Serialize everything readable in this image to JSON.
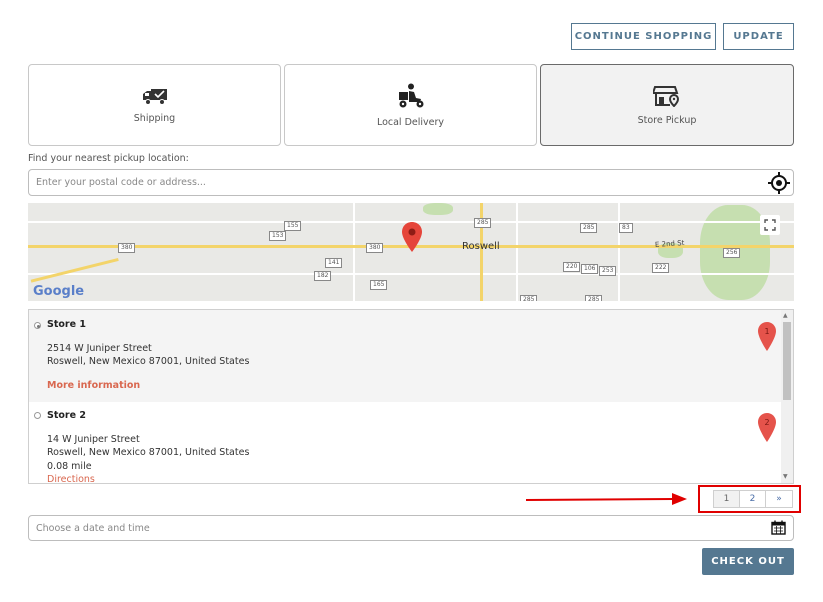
{
  "header": {
    "continue_shopping_label": "CONTINUE SHOPPING",
    "update_label": "UPDATE"
  },
  "tabs": [
    {
      "label": "Shipping",
      "icon": "truck-icon",
      "active": false
    },
    {
      "label": "Local Delivery",
      "icon": "scooter-delivery-icon",
      "active": false
    },
    {
      "label": "Store Pickup",
      "icon": "store-pin-icon",
      "active": true
    }
  ],
  "search": {
    "label": "Find your nearest pickup location:",
    "placeholder": "Enter your postal code or address..."
  },
  "map": {
    "provider_logo": "Google",
    "city_label": "Roswell",
    "street_label": "E 2nd St",
    "road_shields": [
      "155",
      "153",
      "380",
      "380",
      "285",
      "285",
      "83",
      "141",
      "182",
      "165",
      "220",
      "106",
      "253",
      "222",
      "256",
      "285",
      "285"
    ]
  },
  "stores": [
    {
      "name": "Store 1",
      "address_line1": "2514 W Juniper Street",
      "address_line2": "Roswell, New Mexico 87001, United States",
      "link": "More information",
      "marker": "1",
      "selected": true
    },
    {
      "name": "Store 2",
      "address_line1": "14 W Juniper Street",
      "address_line2": "Roswell, New Mexico 87001, United States",
      "distance": "0.08 mile",
      "link": "Directions",
      "marker": "2",
      "selected": false
    }
  ],
  "pagination": {
    "pages": [
      "1",
      "2"
    ],
    "next": "»",
    "current": "1"
  },
  "datetime": {
    "placeholder": "Choose a date and time"
  },
  "checkout_label": "CHECK OUT",
  "colors": {
    "accent": "#557891",
    "link": "#d9674f",
    "marker": "#e5534b",
    "annotation": "#e00000"
  }
}
